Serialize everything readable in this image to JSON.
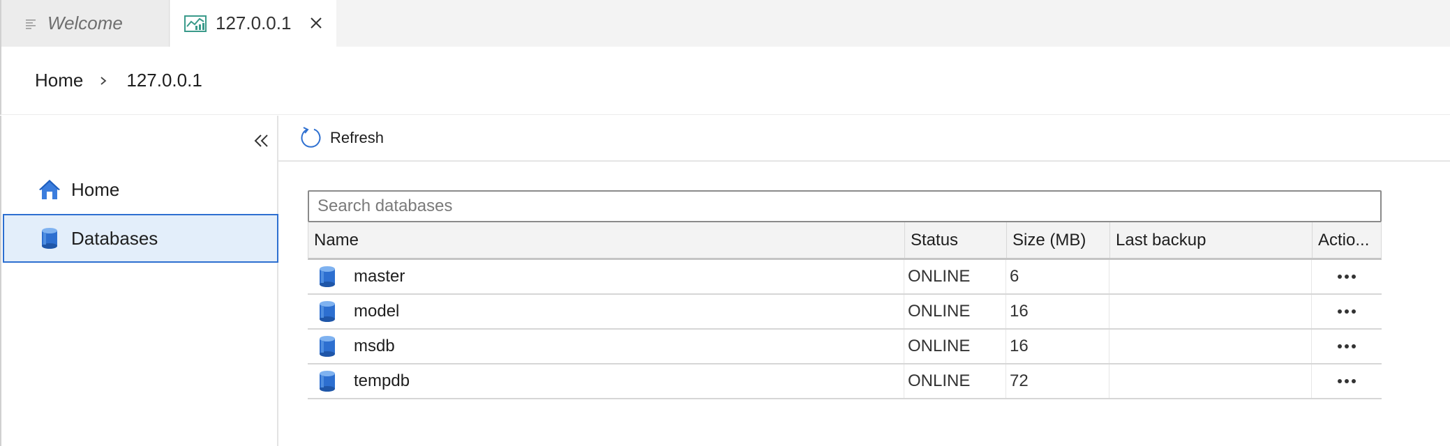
{
  "tabs": [
    {
      "label": "Welcome",
      "icon": "list-icon"
    },
    {
      "label": "127.0.0.1",
      "icon": "server-dashboard-icon",
      "active": true
    }
  ],
  "breadcrumb": {
    "home": "Home",
    "current": "127.0.0.1"
  },
  "sidebar": {
    "items": [
      {
        "label": "Home",
        "icon": "home-icon"
      },
      {
        "label": "Databases",
        "icon": "database-icon",
        "selected": true
      }
    ]
  },
  "toolbar": {
    "refresh_label": "Refresh"
  },
  "search": {
    "placeholder": "Search databases",
    "value": ""
  },
  "table": {
    "headers": [
      "Name",
      "Status",
      "Size (MB)",
      "Last backup",
      "Actio..."
    ],
    "rows": [
      {
        "name": "master",
        "status": "ONLINE",
        "size": "6",
        "last_backup": ""
      },
      {
        "name": "model",
        "status": "ONLINE",
        "size": "16",
        "last_backup": ""
      },
      {
        "name": "msdb",
        "status": "ONLINE",
        "size": "16",
        "last_backup": ""
      },
      {
        "name": "tempdb",
        "status": "ONLINE",
        "size": "72",
        "last_backup": ""
      }
    ]
  },
  "colors": {
    "accent": "#2d6fd0",
    "selected_bg": "#e3eefa",
    "tab_icon": "#3a9a8a"
  }
}
